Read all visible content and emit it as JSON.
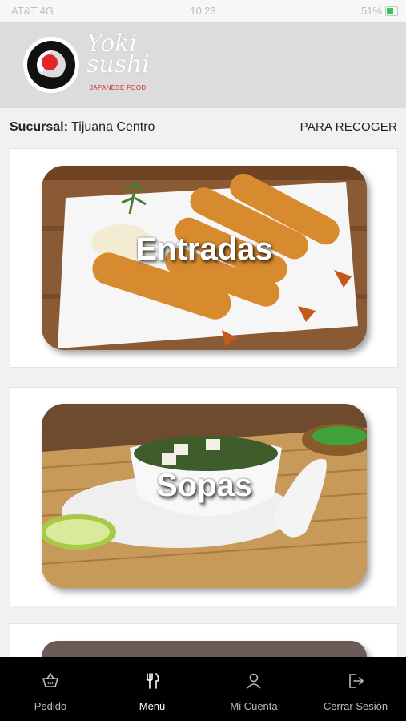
{
  "status_bar": {
    "carrier": "AT&T 4G",
    "time": "10:23",
    "battery": "51%"
  },
  "header": {
    "brand_script_line1": "Yoki",
    "brand_script_line2": "sushi",
    "brand_subtitle": "JAPANESE FOOD"
  },
  "info": {
    "branch_label": "Sucursal:",
    "branch_value": "Tijuana Centro",
    "order_mode": "PARA RECOGER"
  },
  "categories": [
    {
      "label": "Entradas"
    },
    {
      "label": "Sopas"
    },
    {
      "label": ""
    }
  ],
  "tabbar": {
    "items": [
      {
        "label": "Pedido",
        "icon": "basket-icon"
      },
      {
        "label": "Menú",
        "icon": "cutlery-icon"
      },
      {
        "label": "Mi Cuenta",
        "icon": "user-icon"
      },
      {
        "label": "Cerrar Sesión",
        "icon": "logout-icon"
      }
    ],
    "active_index": 1
  }
}
